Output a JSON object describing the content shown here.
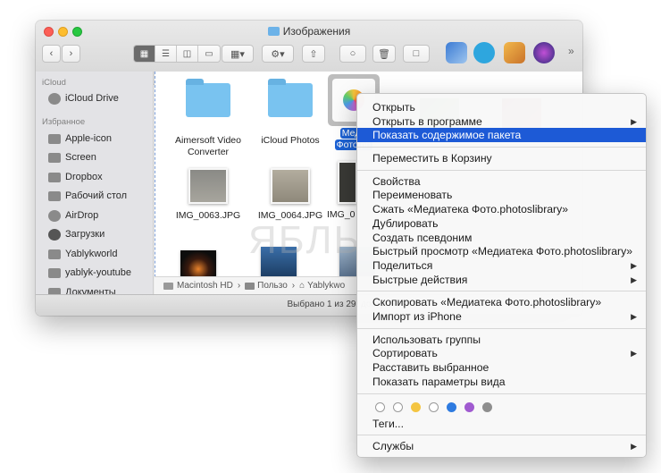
{
  "window": {
    "title": "Изображения",
    "sidebar": {
      "icloud_header": "iCloud",
      "icloud_items": [
        "iCloud Drive"
      ],
      "favorites_header": "Избранное",
      "favorites": [
        "Apple-icon",
        "Screen",
        "Dropbox",
        "Рабочий стол",
        "AirDrop",
        "Загрузки",
        "Yablykworld",
        "yablyk-youtube",
        "Документы"
      ]
    },
    "files": {
      "folder1": [
        "Aimersoft Video",
        "Converter"
      ],
      "folder2": "iCloud Photos",
      "selected": [
        "Меди",
        "Фото.ph"
      ],
      "img1": "IMG_0063.JPG",
      "img2": "IMG_0064.JPG",
      "img3": "IMG_0"
    },
    "path": [
      "Macintosh HD",
      "Пользо",
      "Yablykwo"
    ],
    "status": "Выбрано 1 из 29; доступно 35",
    "watermark": "ЯБЛЫК"
  },
  "toolbar_icons": [
    "back-icon",
    "forward-icon",
    "view-icons",
    "view-list",
    "view-columns",
    "view-gallery",
    "group-icon",
    "gear-icon",
    "share-icon",
    "tag-icon",
    "trash-icon",
    "folder-icon",
    "preview-app",
    "telegram-app",
    "brush-app",
    "siri-app"
  ],
  "menu": {
    "items": [
      "Открыть",
      "Открыть в программе",
      "Показать содержимое пакета",
      "Переместить в Корзину",
      "Свойства",
      "Переименовать",
      "Сжать «Медиатека Фото.photoslibrary»",
      "Дублировать",
      "Создать псевдоним",
      "Быстрый просмотр «Медиатека Фото.photoslibrary»",
      "Поделиться",
      "Быстрые действия",
      "Скопировать «Медиатека Фото.photoslibrary»",
      "Импорт из iPhone",
      "Использовать группы",
      "Сортировать",
      "Расставить выбранное",
      "Показать параметры вида",
      "Теги...",
      "Службы"
    ],
    "tag_colors": [
      "#ffffff",
      "#ffffff",
      "#f4c542",
      "#ffffff",
      "#2e7be0",
      "#a05bd0",
      "#8e8e8e"
    ]
  }
}
